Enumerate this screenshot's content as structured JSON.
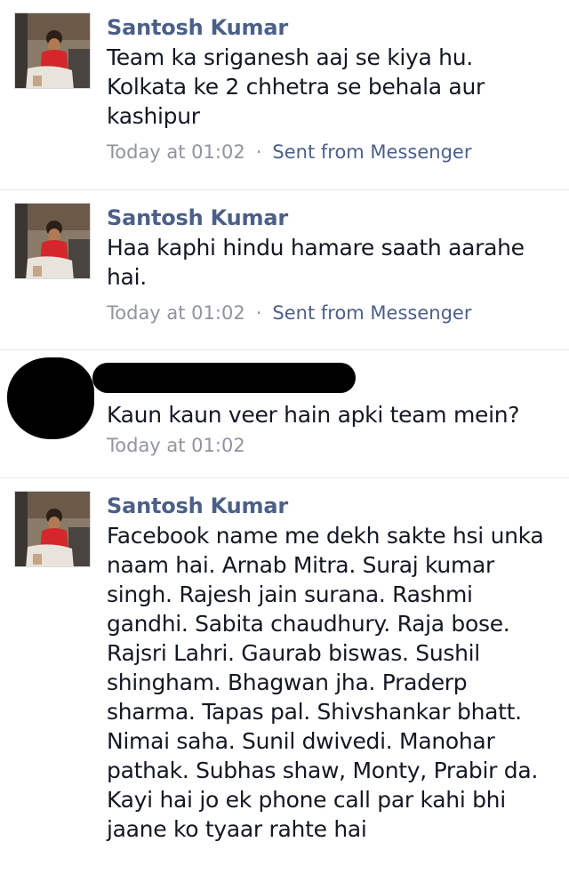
{
  "messages": [
    {
      "sender": "Santosh Kumar",
      "text": "Team ka sriganesh aaj se kiya hu. Kolkata ke 2 chhetra se behala aur kashipur",
      "time": "Today at 01:02",
      "separator": "·",
      "via": "Sent from Messenger"
    },
    {
      "sender": "Santosh Kumar",
      "text": "Haa kaphi hindu hamare saath aarahe hai.",
      "time": "Today at 01:02",
      "separator": "·",
      "via": "Sent from Messenger"
    },
    {
      "sender": "",
      "text": "Kaun kaun veer hain apki team mein?",
      "time": "Today at 01:02"
    },
    {
      "sender": "Santosh Kumar",
      "text": "Facebook name me dekh sakte hsi unka naam hai. Arnab Mitra. Suraj kumar singh. Rajesh jain surana. Rashmi gandhi. Sabita chaudhury. Raja bose. Rajsri Lahri. Gaurab biswas. Sushil shingham. Bhagwan jha. Praderp sharma. Tapas pal. Shivshankar bhatt. Nimai saha. Sunil dwivedi. Manohar pathak. Subhas shaw, Monty, Prabir da. Kayi hai jo ek phone call par kahi bhi jaane ko tyaar rahte hai"
    }
  ]
}
